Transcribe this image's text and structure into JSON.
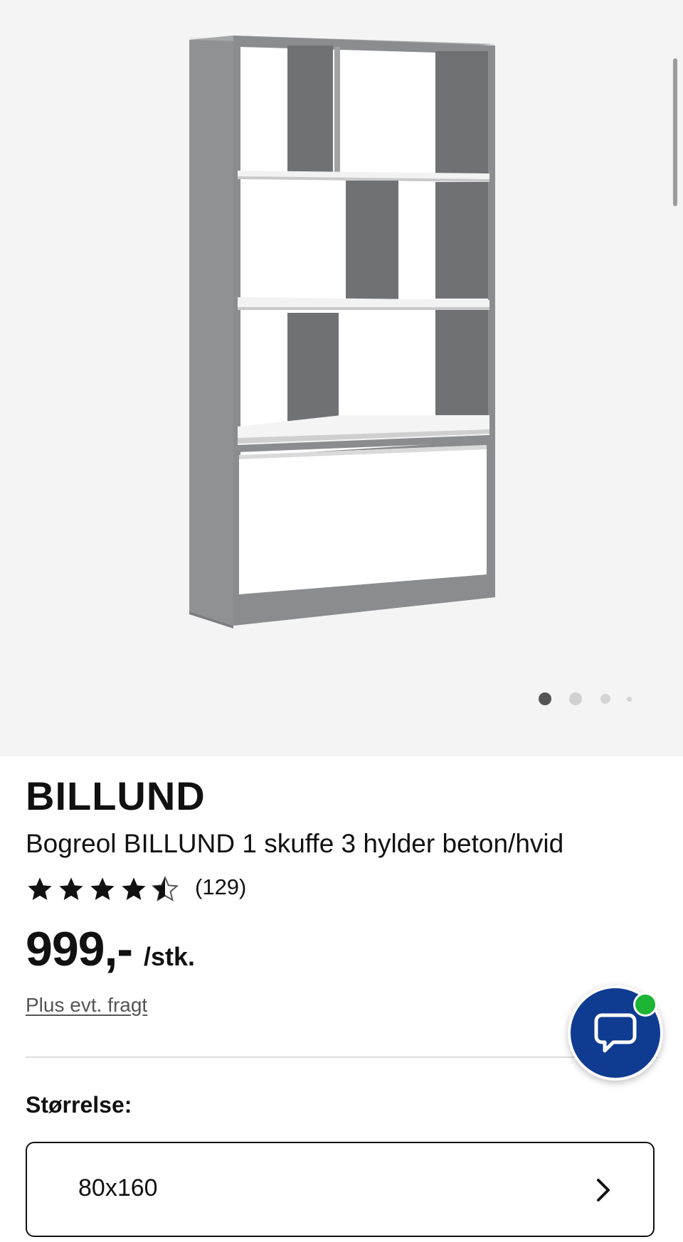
{
  "gallery": {
    "image_label": "Bogreol BILLUND beton/hvid",
    "active_index": 0,
    "total": 4
  },
  "product": {
    "brand": "BILLUND",
    "description": "Bogreol BILLUND 1 skuffe 3 hylder beton/hvid",
    "rating": 4.5,
    "rating_count": "(129)",
    "price": "999,-",
    "unit": "/stk.",
    "freight_link": "Plus evt. fragt"
  },
  "size": {
    "label": "Størrelse:",
    "selected": "80x160"
  },
  "icons": {
    "chat": "chat-bubble-icon",
    "chevron": "chevron-right-icon",
    "star": "star-icon"
  },
  "colors": {
    "chat_button": "#0f3b91",
    "online_indicator": "#1cb535",
    "concrete": "#8e9092",
    "white_panel": "#ffffff"
  }
}
